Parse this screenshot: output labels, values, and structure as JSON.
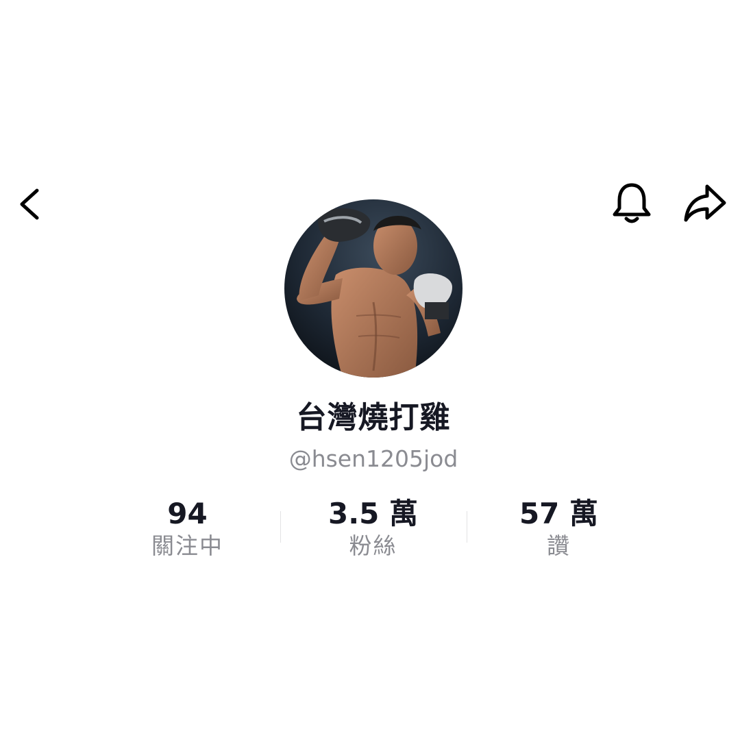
{
  "header": {
    "back_icon": "chevron-left-icon",
    "notification_icon": "bell-icon",
    "share_icon": "share-arrow-icon"
  },
  "profile": {
    "avatar_icon": "avatar",
    "display_name": "台灣燒打雞",
    "username": "@hsen1205jod"
  },
  "stats": [
    {
      "value": "94",
      "label": "關注中"
    },
    {
      "value": "3.5 萬",
      "label": "粉絲"
    },
    {
      "value": "57 萬",
      "label": "讚"
    }
  ],
  "colors": {
    "text_primary": "#161823",
    "text_secondary": "#8a8b91",
    "background": "#ffffff"
  }
}
